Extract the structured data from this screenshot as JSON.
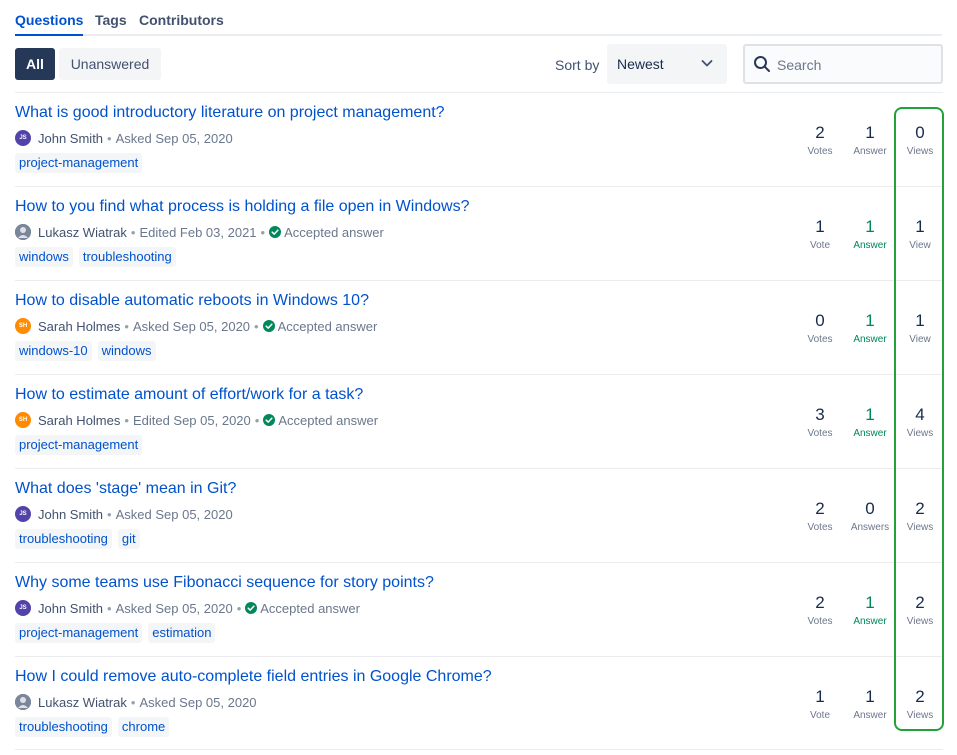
{
  "tabs": [
    {
      "label": "Questions",
      "active": true
    },
    {
      "label": "Tags",
      "active": false
    },
    {
      "label": "Contributors",
      "active": false
    }
  ],
  "filters": {
    "all_label": "All",
    "unanswered_label": "Unanswered"
  },
  "sort": {
    "label": "Sort by",
    "value": "Newest"
  },
  "search": {
    "placeholder": "Search",
    "value": ""
  },
  "colors": {
    "primary": "#0052cc",
    "accepted": "#00875a",
    "highlight": "#22a33a",
    "dark_button": "#253858"
  },
  "questions": [
    {
      "title": "What is good introductory literature on project management?",
      "avatar": "JS",
      "avatar_icon": "avatar-js",
      "author": "John Smith",
      "action": "Asked Sep 05, 2020",
      "accepted": "",
      "tags": [
        "project-management"
      ],
      "votes": "2",
      "votes_label": "Votes",
      "answers": "1",
      "answers_label": "Answer",
      "views": "0",
      "views_label": "Views"
    },
    {
      "title": "How to you find what process is holding a file open in Windows?",
      "avatar": "",
      "avatar_icon": "avatar-photo",
      "author": "Lukasz Wiatrak",
      "action": "Edited Feb 03, 2021",
      "accepted": "Accepted answer",
      "tags": [
        "windows",
        "troubleshooting"
      ],
      "votes": "1",
      "votes_label": "Vote",
      "answers": "1",
      "answers_label": "Answer",
      "views": "1",
      "views_label": "View"
    },
    {
      "title": "How to disable automatic reboots in Windows 10?",
      "avatar": "SH",
      "avatar_icon": "avatar-sh",
      "author": "Sarah Holmes",
      "action": "Asked Sep 05, 2020",
      "accepted": "Accepted answer",
      "tags": [
        "windows-10",
        "windows"
      ],
      "votes": "0",
      "votes_label": "Votes",
      "answers": "1",
      "answers_label": "Answer",
      "views": "1",
      "views_label": "View"
    },
    {
      "title": "How to estimate amount of effort/work for a task?",
      "avatar": "SH",
      "avatar_icon": "avatar-sh",
      "author": "Sarah Holmes",
      "action": "Edited Sep 05, 2020",
      "accepted": "Accepted answer",
      "tags": [
        "project-management"
      ],
      "votes": "3",
      "votes_label": "Votes",
      "answers": "1",
      "answers_label": "Answer",
      "views": "4",
      "views_label": "Views"
    },
    {
      "title": "What does 'stage' mean in Git?",
      "avatar": "JS",
      "avatar_icon": "avatar-js",
      "author": "John Smith",
      "action": "Asked Sep 05, 2020",
      "accepted": "",
      "tags": [
        "troubleshooting",
        "git"
      ],
      "votes": "2",
      "votes_label": "Votes",
      "answers": "0",
      "answers_label": "Answers",
      "views": "2",
      "views_label": "Views"
    },
    {
      "title": "Why some teams use Fibonacci sequence for story points?",
      "avatar": "JS",
      "avatar_icon": "avatar-js",
      "author": "John Smith",
      "action": "Asked Sep 05, 2020",
      "accepted": "Accepted answer",
      "tags": [
        "project-management",
        "estimation"
      ],
      "votes": "2",
      "votes_label": "Votes",
      "answers": "1",
      "answers_label": "Answer",
      "views": "2",
      "views_label": "Views"
    },
    {
      "title": "How I could remove auto-complete field entries in Google Chrome?",
      "avatar": "",
      "avatar_icon": "avatar-photo",
      "author": "Lukasz Wiatrak",
      "action": "Asked Sep 05, 2020",
      "accepted": "",
      "tags": [
        "troubleshooting",
        "chrome"
      ],
      "votes": "1",
      "votes_label": "Vote",
      "answers": "1",
      "answers_label": "Answer",
      "views": "2",
      "views_label": "Views"
    }
  ]
}
